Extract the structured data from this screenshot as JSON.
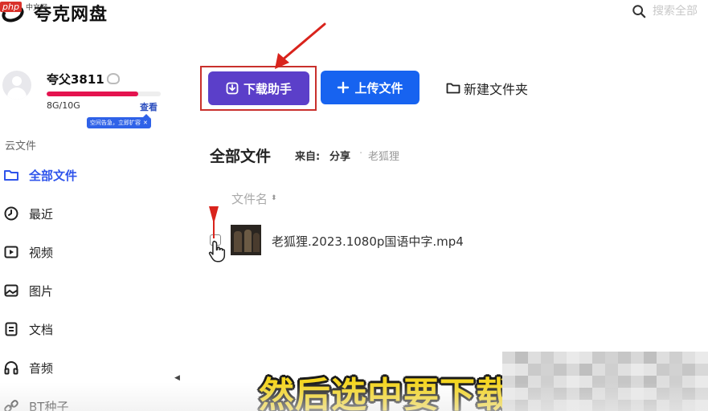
{
  "header": {
    "logo_text": "夸克网盘",
    "watermark_php": "php",
    "watermark_site": "中文网",
    "search_placeholder": "搜索全部"
  },
  "user": {
    "name": "夸父3811",
    "quota_text": "8G/10G",
    "quota_fraction": 0.8,
    "view_label": "查看",
    "tip_text": "空间告急，立即扩容"
  },
  "sidebar": {
    "section_title": "云文件",
    "items": [
      {
        "label": "全部文件",
        "icon": "folder-icon",
        "active": true
      },
      {
        "label": "最近",
        "icon": "clock-icon",
        "active": false
      },
      {
        "label": "视频",
        "icon": "video-icon",
        "active": false
      },
      {
        "label": "图片",
        "icon": "image-icon",
        "active": false
      },
      {
        "label": "文档",
        "icon": "document-icon",
        "active": false
      },
      {
        "label": "音频",
        "icon": "headphones-icon",
        "active": false
      },
      {
        "label": "BT种子",
        "icon": "link-icon",
        "active": false
      }
    ],
    "collapse_glyph": "◀"
  },
  "toolbar": {
    "download_label": "下载助手",
    "upload_label": "上传文件",
    "new_folder_label": "新建文件夹"
  },
  "breadcrumb": {
    "title": "全部文件",
    "from_label": "来自:",
    "share_label": "分享",
    "separator": "·",
    "folder": "老狐狸"
  },
  "file_list": {
    "column_name": "文件名",
    "sort_glyph": "⬍",
    "files": [
      {
        "name": "老狐狸.2023.1080p国语中字.mp4",
        "type": "video"
      }
    ]
  },
  "subtitle": "然后选中要下载",
  "colors": {
    "accent_blue": "#1763f0",
    "download_purple": "#5b3fc9",
    "highlight_red": "#c9302c",
    "quota_red": "#e4134f",
    "subtitle_yellow": "#f4d520"
  }
}
